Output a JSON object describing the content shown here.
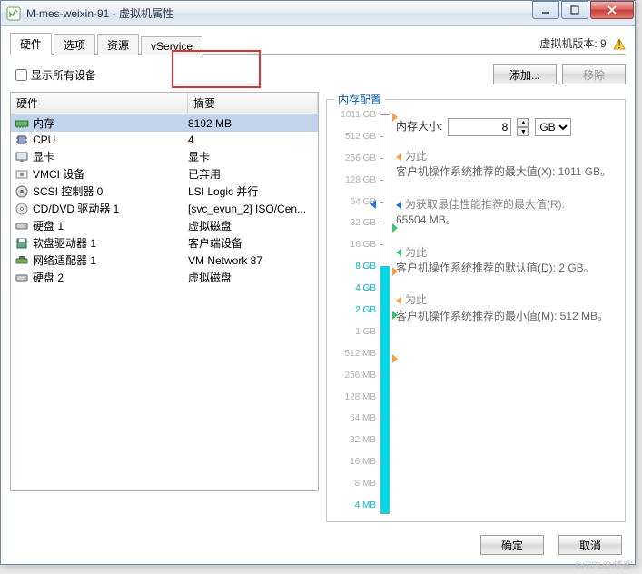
{
  "window": {
    "title": "M-mes-weixin-91 - 虚拟机属性"
  },
  "tabs": {
    "t0": "硬件",
    "t1": "选项",
    "t2": "资源",
    "t3": "vService"
  },
  "version": "虚拟机版本: 9",
  "toolbar": {
    "show_all": "显示所有设备",
    "add": "添加...",
    "remove": "移除"
  },
  "table": {
    "col_hw": "硬件",
    "col_summary": "摘要",
    "rows": [
      {
        "name": "内存",
        "summary": "8192 MB",
        "icon": "mem"
      },
      {
        "name": "CPU",
        "summary": "4",
        "icon": "cpu"
      },
      {
        "name": "显卡",
        "summary": "显卡",
        "icon": "video"
      },
      {
        "name": "VMCI 设备",
        "summary": "已弃用",
        "icon": "vmci"
      },
      {
        "name": "SCSI 控制器  0",
        "summary": "LSI Logic 并行",
        "icon": "scsi"
      },
      {
        "name": "CD/DVD 驱动器 1",
        "summary": "[svc_evun_2] ISO/Cen...",
        "icon": "cd"
      },
      {
        "name": "硬盘 1",
        "summary": "虚拟磁盘",
        "icon": "disk"
      },
      {
        "name": "软盘驱动器 1",
        "summary": "客户端设备",
        "icon": "floppy"
      },
      {
        "name": "网络适配器 1",
        "summary": "VM Network 87",
        "icon": "net"
      },
      {
        "name": "硬盘 2",
        "summary": "虚拟磁盘",
        "icon": "disk"
      }
    ]
  },
  "memory": {
    "legend": "内存配置",
    "size_label": "内存大小:",
    "size_value": "8",
    "size_unit": "GB",
    "scale": [
      "1011 GB",
      "512 GB",
      "256 GB",
      "128 GB",
      "64 GB",
      "32 GB",
      "16 GB",
      "8 GB",
      "4 GB",
      "2 GB",
      "1 GB",
      "512 MB",
      "256 MB",
      "128 MB",
      "64 MB",
      "32 MB",
      "16 MB",
      "8 MB",
      "4 MB"
    ],
    "desc": [
      {
        "label": "为此",
        "text": "客户机操作系统推荐的最大值(X): 1011 GB。",
        "color": "#f2a24a"
      },
      {
        "label": "为获取最佳性能推荐的最大值(R):",
        "text": "65504 MB。",
        "color": "#2a6fd6"
      },
      {
        "label": "为此",
        "text": "客户机操作系统推荐的默认值(D): 2 GB。",
        "color": "#3fbf6f"
      },
      {
        "label": "为此",
        "text": "客户机操作系统推荐的最小值(M): 512 MB。",
        "color": "#f2a24a"
      }
    ]
  },
  "footer": {
    "ok": "确定",
    "cancel": "取消"
  },
  "watermark": "©ITPUB博客"
}
